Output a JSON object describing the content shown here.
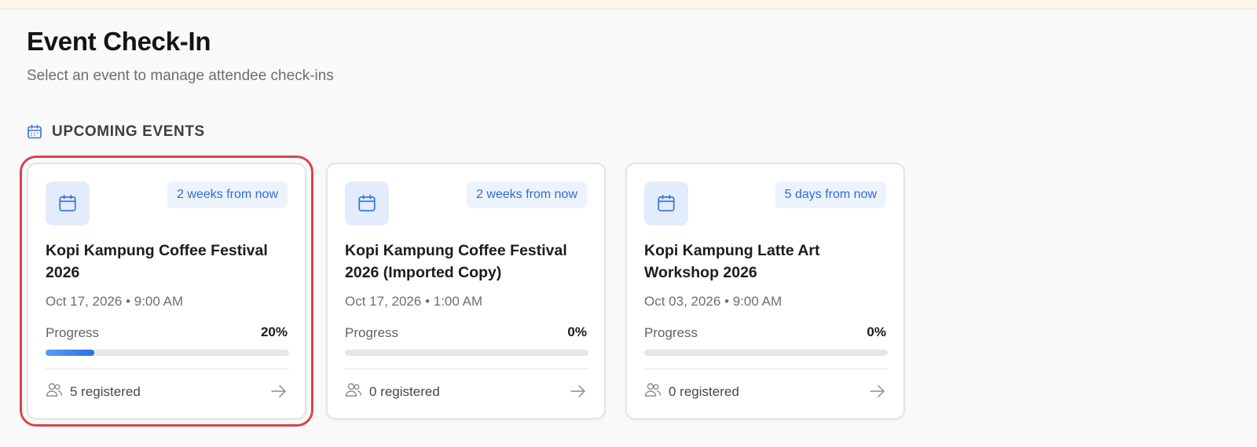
{
  "page": {
    "title": "Event Check-In",
    "subtitle": "Select an event to manage attendee check-ins"
  },
  "section": {
    "title": "UPCOMING EVENTS",
    "icon": "calendar-icon"
  },
  "colors": {
    "accent": "#2e6bd9",
    "selected_outline": "#d64550"
  },
  "events": [
    {
      "badge": "2 weeks from now",
      "title": "Kopi Kampung Coffee Festival 2026",
      "datetime": "Oct 17, 2026 • 9:00 AM",
      "progress_label": "Progress",
      "progress_text": "20%",
      "progress": 0.2,
      "registered": "5 registered",
      "selected": true
    },
    {
      "badge": "2 weeks from now",
      "title": "Kopi Kampung Coffee Festival 2026 (Imported Copy)",
      "datetime": "Oct 17, 2026 • 1:00 AM",
      "progress_label": "Progress",
      "progress_text": "0%",
      "progress": 0,
      "registered": "0 registered",
      "selected": false
    },
    {
      "badge": "5 days from now",
      "title": "Kopi Kampung Latte Art Workshop 2026",
      "datetime": "Oct 03, 2026 • 9:00 AM",
      "progress_label": "Progress",
      "progress_text": "0%",
      "progress": 0,
      "registered": "0 registered",
      "selected": false
    }
  ]
}
